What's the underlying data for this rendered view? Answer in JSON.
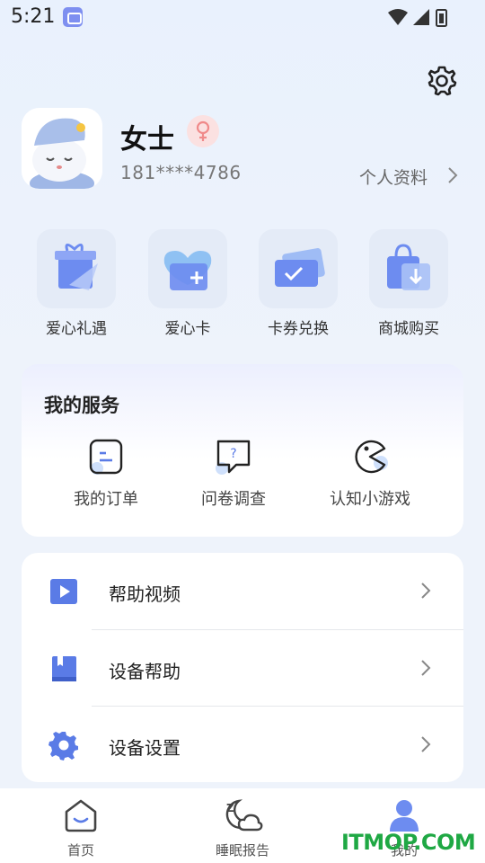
{
  "status_bar": {
    "time": "5:21"
  },
  "profile": {
    "name": "女士",
    "phone": "181****4786",
    "profile_link": "个人资料"
  },
  "quick_actions": [
    {
      "label": "爱心礼遇",
      "icon": "gift-icon"
    },
    {
      "label": "爱心卡",
      "icon": "heart-card-icon"
    },
    {
      "label": "卡券兑换",
      "icon": "ticket-icon"
    },
    {
      "label": "商城购买",
      "icon": "shopping-bag-icon"
    }
  ],
  "services": {
    "title": "我的服务",
    "items": [
      {
        "label": "我的订单",
        "icon": "order-icon"
      },
      {
        "label": "问卷调查",
        "icon": "survey-icon"
      },
      {
        "label": "认知小游戏",
        "icon": "game-icon"
      }
    ]
  },
  "menu": [
    {
      "label": "帮助视频",
      "icon": "play-video-icon"
    },
    {
      "label": "设备帮助",
      "icon": "book-icon"
    },
    {
      "label": "设备设置",
      "icon": "gear-icon"
    }
  ],
  "tabs": [
    {
      "label": "首页",
      "icon": "home-icon"
    },
    {
      "label": "睡眠报告",
      "icon": "sleep-report-icon"
    },
    {
      "label": "我的",
      "icon": "user-icon"
    }
  ],
  "watermark": "ITMOP.COM",
  "colors": {
    "accent": "#5b6ee8",
    "icon_blue": "#5a7be6",
    "female_pink": "#f08a8a",
    "watermark_green": "#1fa844"
  }
}
